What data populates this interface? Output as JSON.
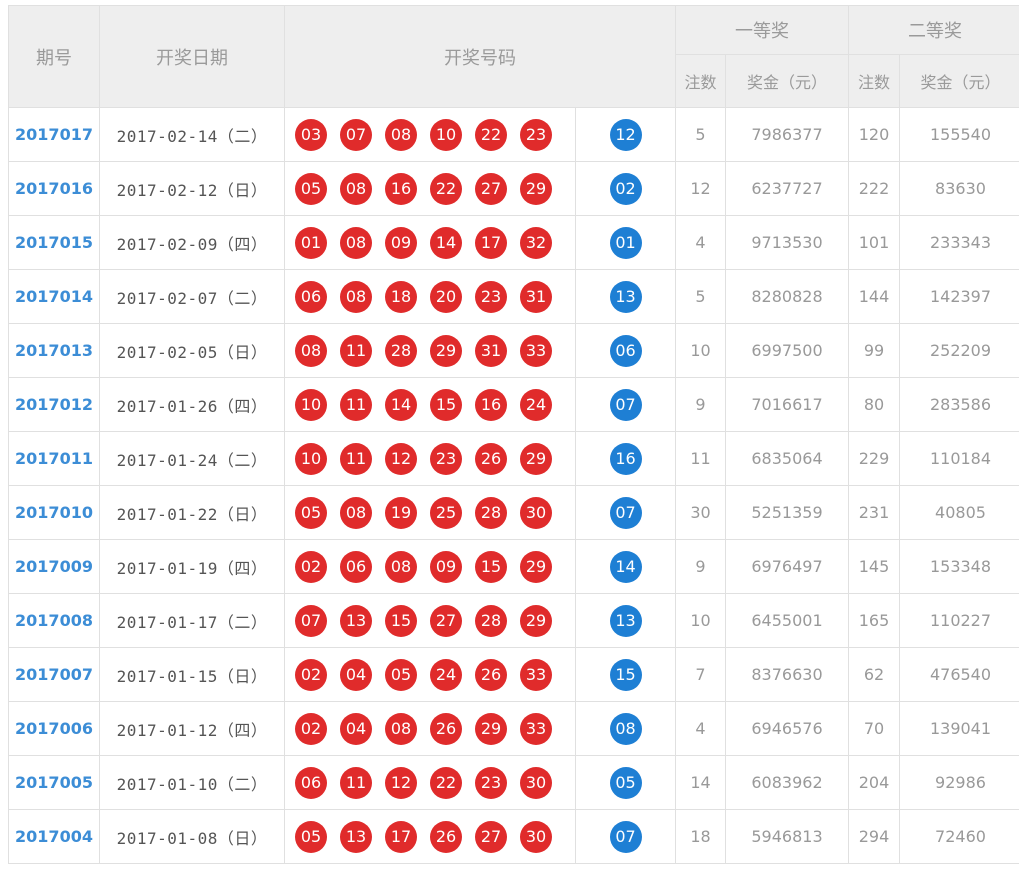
{
  "header": {
    "issue": "期号",
    "date": "开奖日期",
    "numbers": "开奖号码",
    "prize1": "一等奖",
    "prize2": "二等奖",
    "count": "注数",
    "amount": "奖金（元）"
  },
  "colors": {
    "red_ball": "#e02b2b",
    "blue_ball": "#1e7fd4",
    "issue_link": "#3c8dd6",
    "header_bg": "#eeeeee"
  },
  "draws": [
    {
      "issue": "2017017",
      "date": "2017-02-14（二）",
      "reds": [
        "03",
        "07",
        "08",
        "10",
        "22",
        "23"
      ],
      "blue": "12",
      "p1_count": "5",
      "p1_amount": "7986377",
      "p2_count": "120",
      "p2_amount": "155540"
    },
    {
      "issue": "2017016",
      "date": "2017-02-12（日）",
      "reds": [
        "05",
        "08",
        "16",
        "22",
        "27",
        "29"
      ],
      "blue": "02",
      "p1_count": "12",
      "p1_amount": "6237727",
      "p2_count": "222",
      "p2_amount": "83630"
    },
    {
      "issue": "2017015",
      "date": "2017-02-09（四）",
      "reds": [
        "01",
        "08",
        "09",
        "14",
        "17",
        "32"
      ],
      "blue": "01",
      "p1_count": "4",
      "p1_amount": "9713530",
      "p2_count": "101",
      "p2_amount": "233343"
    },
    {
      "issue": "2017014",
      "date": "2017-02-07（二）",
      "reds": [
        "06",
        "08",
        "18",
        "20",
        "23",
        "31"
      ],
      "blue": "13",
      "p1_count": "5",
      "p1_amount": "8280828",
      "p2_count": "144",
      "p2_amount": "142397"
    },
    {
      "issue": "2017013",
      "date": "2017-02-05（日）",
      "reds": [
        "08",
        "11",
        "28",
        "29",
        "31",
        "33"
      ],
      "blue": "06",
      "p1_count": "10",
      "p1_amount": "6997500",
      "p2_count": "99",
      "p2_amount": "252209"
    },
    {
      "issue": "2017012",
      "date": "2017-01-26（四）",
      "reds": [
        "10",
        "11",
        "14",
        "15",
        "16",
        "24"
      ],
      "blue": "07",
      "p1_count": "9",
      "p1_amount": "7016617",
      "p2_count": "80",
      "p2_amount": "283586"
    },
    {
      "issue": "2017011",
      "date": "2017-01-24（二）",
      "reds": [
        "10",
        "11",
        "12",
        "23",
        "26",
        "29"
      ],
      "blue": "16",
      "p1_count": "11",
      "p1_amount": "6835064",
      "p2_count": "229",
      "p2_amount": "110184"
    },
    {
      "issue": "2017010",
      "date": "2017-01-22（日）",
      "reds": [
        "05",
        "08",
        "19",
        "25",
        "28",
        "30"
      ],
      "blue": "07",
      "p1_count": "30",
      "p1_amount": "5251359",
      "p2_count": "231",
      "p2_amount": "40805"
    },
    {
      "issue": "2017009",
      "date": "2017-01-19（四）",
      "reds": [
        "02",
        "06",
        "08",
        "09",
        "15",
        "29"
      ],
      "blue": "14",
      "p1_count": "9",
      "p1_amount": "6976497",
      "p2_count": "145",
      "p2_amount": "153348"
    },
    {
      "issue": "2017008",
      "date": "2017-01-17（二）",
      "reds": [
        "07",
        "13",
        "15",
        "27",
        "28",
        "29"
      ],
      "blue": "13",
      "p1_count": "10",
      "p1_amount": "6455001",
      "p2_count": "165",
      "p2_amount": "110227"
    },
    {
      "issue": "2017007",
      "date": "2017-01-15（日）",
      "reds": [
        "02",
        "04",
        "05",
        "24",
        "26",
        "33"
      ],
      "blue": "15",
      "p1_count": "7",
      "p1_amount": "8376630",
      "p2_count": "62",
      "p2_amount": "476540"
    },
    {
      "issue": "2017006",
      "date": "2017-01-12（四）",
      "reds": [
        "02",
        "04",
        "08",
        "26",
        "29",
        "33"
      ],
      "blue": "08",
      "p1_count": "4",
      "p1_amount": "6946576",
      "p2_count": "70",
      "p2_amount": "139041"
    },
    {
      "issue": "2017005",
      "date": "2017-01-10（二）",
      "reds": [
        "06",
        "11",
        "12",
        "22",
        "23",
        "30"
      ],
      "blue": "05",
      "p1_count": "14",
      "p1_amount": "6083962",
      "p2_count": "204",
      "p2_amount": "92986"
    },
    {
      "issue": "2017004",
      "date": "2017-01-08（日）",
      "reds": [
        "05",
        "13",
        "17",
        "26",
        "27",
        "30"
      ],
      "blue": "07",
      "p1_count": "18",
      "p1_amount": "5946813",
      "p2_count": "294",
      "p2_amount": "72460"
    }
  ]
}
